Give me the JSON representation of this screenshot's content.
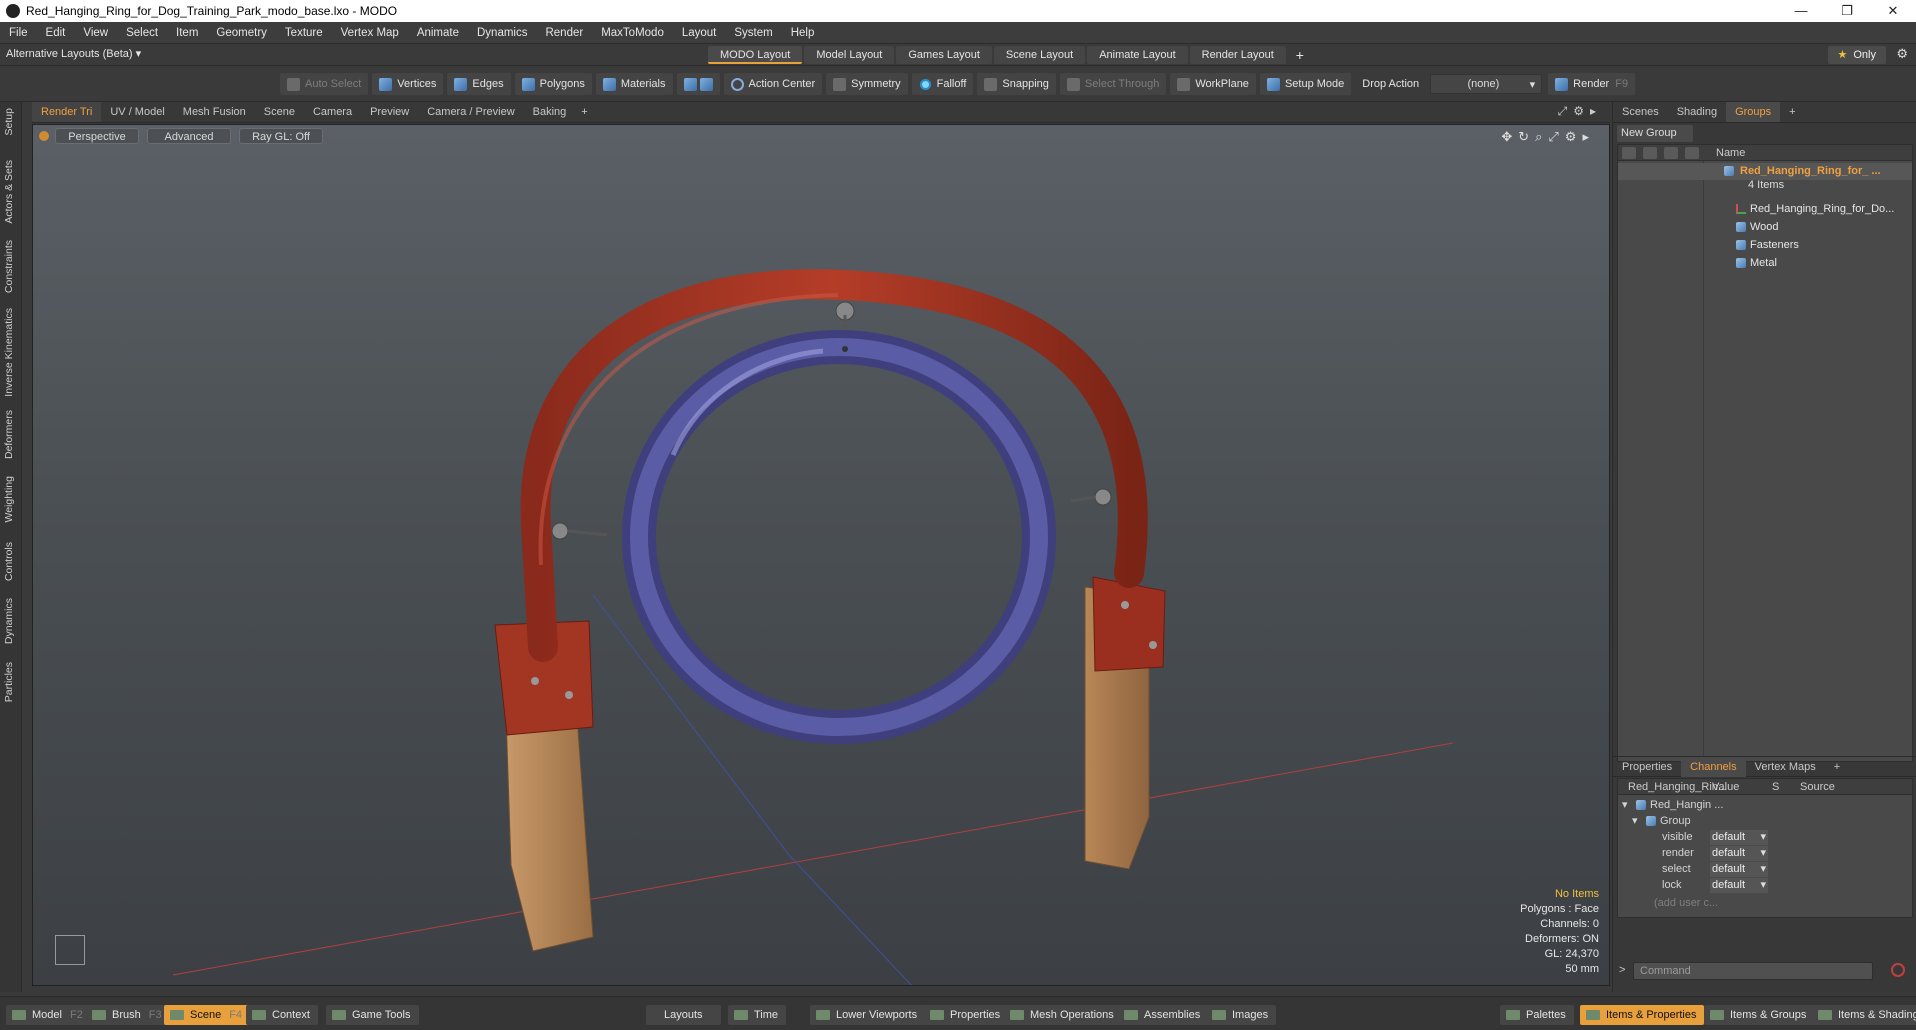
{
  "window": {
    "title": "Red_Hanging_Ring_for_Dog_Training_Park_modo_base.lxo - MODO",
    "controls": [
      "—",
      "❐",
      "✕"
    ]
  },
  "menu": [
    "File",
    "Edit",
    "View",
    "Select",
    "Item",
    "Geometry",
    "Texture",
    "Vertex Map",
    "Animate",
    "Dynamics",
    "Render",
    "MaxToModo",
    "Layout",
    "System",
    "Help"
  ],
  "layoutbar": {
    "alt_layout": "Alternative Layouts (Beta) ▾",
    "tabs": [
      "MODO Layout",
      "Model Layout",
      "Games Layout",
      "Scene Layout",
      "Animate Layout",
      "Render Layout"
    ],
    "add": "+",
    "only": "Only"
  },
  "toolbar": {
    "auto_select": "Auto Select",
    "vertices": "Vertices",
    "edges": "Edges",
    "polygons": "Polygons",
    "materials": "Materials",
    "action_center": "Action Center",
    "symmetry": "Symmetry",
    "falloff": "Falloff",
    "snapping": "Snapping",
    "select_through": "Select Through",
    "workplane": "WorkPlane",
    "setup_mode": "Setup Mode",
    "drop_action": "Drop Action",
    "drop_value": "(none)",
    "render": "Render",
    "render_key": "F9"
  },
  "left_tabs": [
    "Setup",
    "Actors & Sets",
    "Constraints",
    "Inverse Kinematics",
    "Deformers",
    "Weighting",
    "Controls",
    "Dynamics",
    "Particles"
  ],
  "viewport_tabs": [
    "Render Tri",
    "UV / Model",
    "Mesh Fusion",
    "Scene",
    "Camera",
    "Preview",
    "Camera / Preview",
    "Baking"
  ],
  "viewport": {
    "perspective": "Perspective",
    "advanced": "Advanced",
    "raygl": "Ray GL: Off",
    "info": {
      "no_items": "No Items",
      "polygons": "Polygons : Face",
      "channels": "Channels: 0",
      "deformers": "Deformers: ON",
      "gl": "GL: 24,370",
      "focal": "50 mm"
    }
  },
  "right_panel": {
    "tabs": [
      "Scenes",
      "Shading",
      "Groups"
    ],
    "new_group": "New Group",
    "name_header": "Name",
    "group_name": "Red_Hanging_Ring_for_ ...",
    "group_count": "4 Items",
    "items": [
      {
        "label": "Red_Hanging_Ring_for_Do...",
        "type": "locator"
      },
      {
        "label": "Wood",
        "type": "mesh"
      },
      {
        "label": "Fasteners",
        "type": "mesh"
      },
      {
        "label": "Metal",
        "type": "mesh"
      }
    ],
    "props_tabs": [
      "Properties",
      "Channels",
      "Vertex Maps"
    ],
    "channels_header": {
      "name": "Red_Hanging_Rin...",
      "value": "Value",
      "s": "S",
      "source": "Source"
    },
    "channel_item": "Red_Hangin ...",
    "channel_group": "Group",
    "channels": [
      {
        "name": "visible",
        "value": "default"
      },
      {
        "name": "render",
        "value": "default"
      },
      {
        "name": "select",
        "value": "default"
      },
      {
        "name": "lock",
        "value": "default"
      }
    ],
    "add_user": "(add user c...",
    "command_placeholder": "Command"
  },
  "bottom": {
    "model": "Model",
    "model_key": "F2",
    "brush": "Brush",
    "brush_key": "F3",
    "scene": "Scene",
    "scene_key": "F4",
    "context": "Context",
    "game_tools": "Game Tools",
    "layouts": "Layouts",
    "time": "Time",
    "lower_viewports": "Lower Viewports",
    "properties": "Properties",
    "mesh_operations": "Mesh Operations",
    "assemblies": "Assemblies",
    "images": "Images",
    "palettes": "Palettes",
    "items_properties": "Items & Properties",
    "items_groups": "Items & Groups",
    "items_shading": "Items & Shading"
  },
  "colors": {
    "accent": "#e8a03c",
    "ring": "#4b4c8e",
    "frame": "#a33523",
    "wood": "#b08458"
  }
}
